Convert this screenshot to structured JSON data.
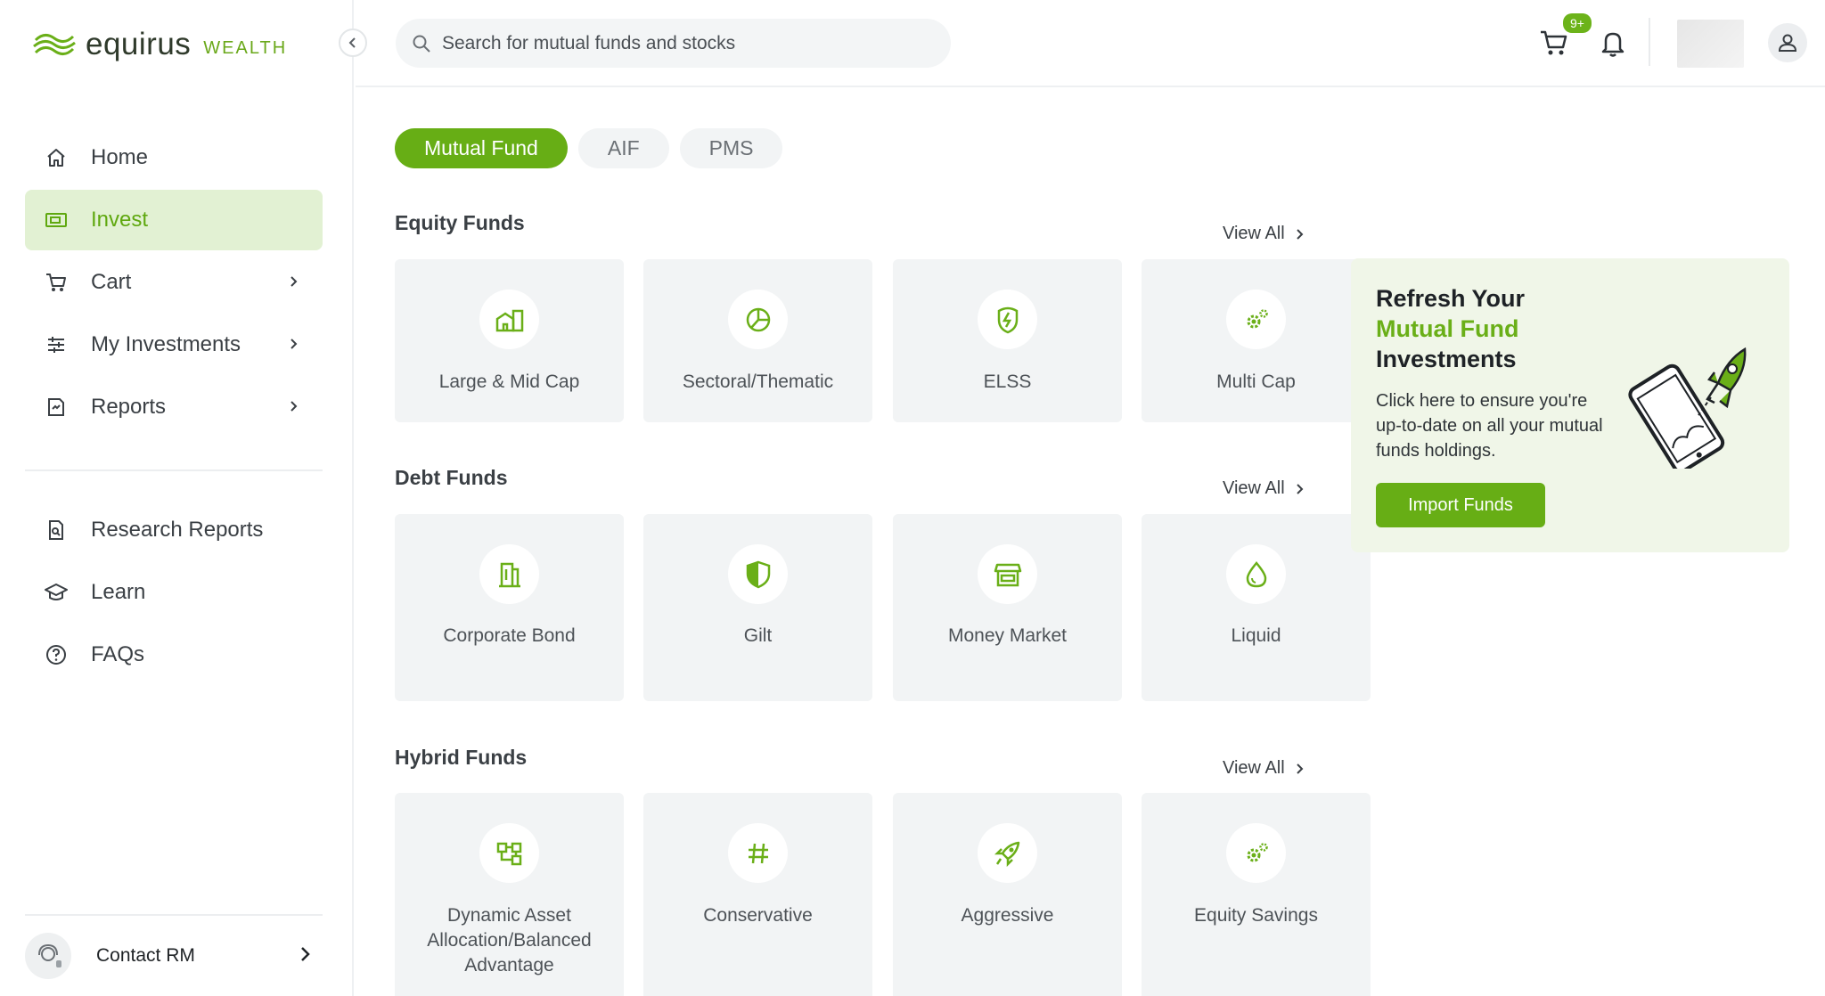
{
  "brand": {
    "name": "equirus",
    "sub": "WEALTH",
    "accent": "#67ae15"
  },
  "sidebar": {
    "items": [
      {
        "label": "Home",
        "icon": "home-icon"
      },
      {
        "label": "Invest",
        "icon": "wallet-icon"
      },
      {
        "label": "Cart",
        "icon": "cart-icon"
      },
      {
        "label": "My Investments",
        "icon": "sliders-icon"
      },
      {
        "label": "Reports",
        "icon": "report-icon"
      }
    ],
    "secondary": [
      {
        "label": "Research Reports",
        "icon": "document-search-icon"
      },
      {
        "label": "Learn",
        "icon": "graduation-cap-icon"
      },
      {
        "label": "FAQs",
        "icon": "help-circle-icon"
      }
    ],
    "contact_label": "Contact RM"
  },
  "header": {
    "search_placeholder": "Search for mutual funds and stocks",
    "cart_badge": "9+"
  },
  "tabs": [
    "Mutual Fund",
    "AIF",
    "PMS"
  ],
  "sections": [
    {
      "title": "Equity Funds",
      "view_all": "View All",
      "cards": [
        "Large & Mid Cap",
        "Sectoral/Thematic",
        "ELSS",
        "Multi Cap"
      ]
    },
    {
      "title": "Debt Funds",
      "view_all": "View All",
      "cards": [
        "Corporate Bond",
        "Gilt",
        "Money Market",
        "Liquid"
      ]
    },
    {
      "title": "Hybrid Funds",
      "view_all": "View All",
      "cards": [
        "Dynamic Asset Allocation/Balanced Advantage",
        "Conservative",
        "Aggressive",
        "Equity Savings"
      ]
    }
  ],
  "promo": {
    "line1": "Refresh Your",
    "line2": "Mutual Fund",
    "line3": "Investments",
    "description": "Click here to ensure you're up-to-date on all your mutual funds holdings.",
    "button": "Import Funds"
  }
}
